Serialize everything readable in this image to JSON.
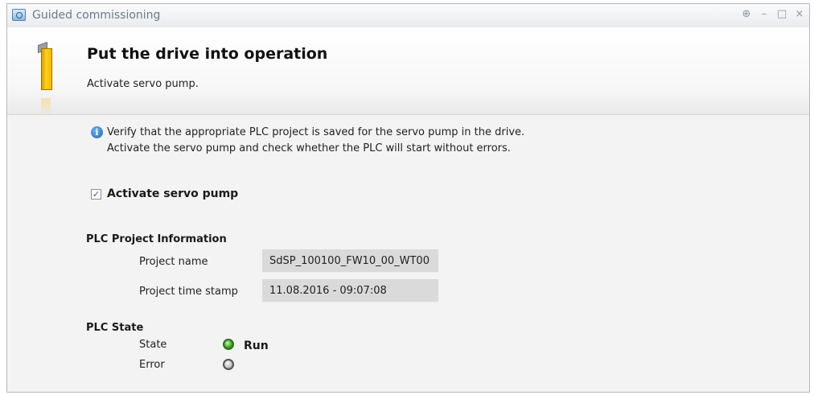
{
  "window": {
    "title": "Guided commissioning",
    "controls": [
      "⊕",
      "–",
      "□",
      "×"
    ]
  },
  "header": {
    "title": "Put the drive into operation",
    "subtitle": "Activate servo pump.",
    "icon": "drive-icon"
  },
  "info": {
    "icon": "info-icon",
    "line1": "Verify that the appropriate PLC project is saved for the servo pump in the drive.",
    "line2": "Activate the servo pump and check whether the PLC will start without errors."
  },
  "activate": {
    "label": "Activate servo pump",
    "checked": true,
    "check_mark": "✓"
  },
  "plc_project": {
    "heading": "PLC Project Information",
    "name_label": "Project name",
    "name_value": "SdSP_100100_FW10_00_WT00",
    "timestamp_label": "Project time stamp",
    "timestamp_value": "11.08.2016 - 09:07:08"
  },
  "plc_state": {
    "heading": "PLC State",
    "state_label": "State",
    "state_value": "Run",
    "state_led": "green",
    "error_label": "Error",
    "error_led": "gray"
  },
  "colors": {
    "led_run": "#3fae20",
    "led_off": "#bdbdbd",
    "field_bg": "#dadada",
    "accent": "#1f63b8"
  }
}
